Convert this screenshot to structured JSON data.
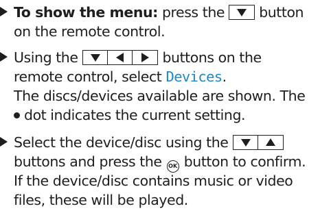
{
  "step1": {
    "lead": "To show the menu:",
    "text_after_lead": "press the",
    "text_after_key": "button",
    "line2": "on the remote control."
  },
  "step2": {
    "line1_start": "Using the",
    "line1_end": "buttons on the",
    "line2_start": "remote control, select",
    "menu_item": "Devices",
    "line2_end": ".",
    "line3": "The discs/devices available are shown. The",
    "line4": "dot indicates the current setting."
  },
  "step3": {
    "line1_start": "Select the device/disc using the",
    "line2_start": "buttons and press the",
    "ok_label": "OK",
    "line2_end": "button to confirm.",
    "line3": "If the device/disc contains music or video",
    "line4": "files, these will be played."
  },
  "icons": {
    "bullet": "right-pointing-triangle",
    "keys": [
      "down-arrow",
      "left-arrow",
      "right-arrow",
      "up-arrow"
    ],
    "ok_button": "ok-button-circle",
    "current_setting_dot": "filled-dot"
  },
  "colors": {
    "text": "#1e1e1e",
    "menu_item": "#1b88c8"
  }
}
